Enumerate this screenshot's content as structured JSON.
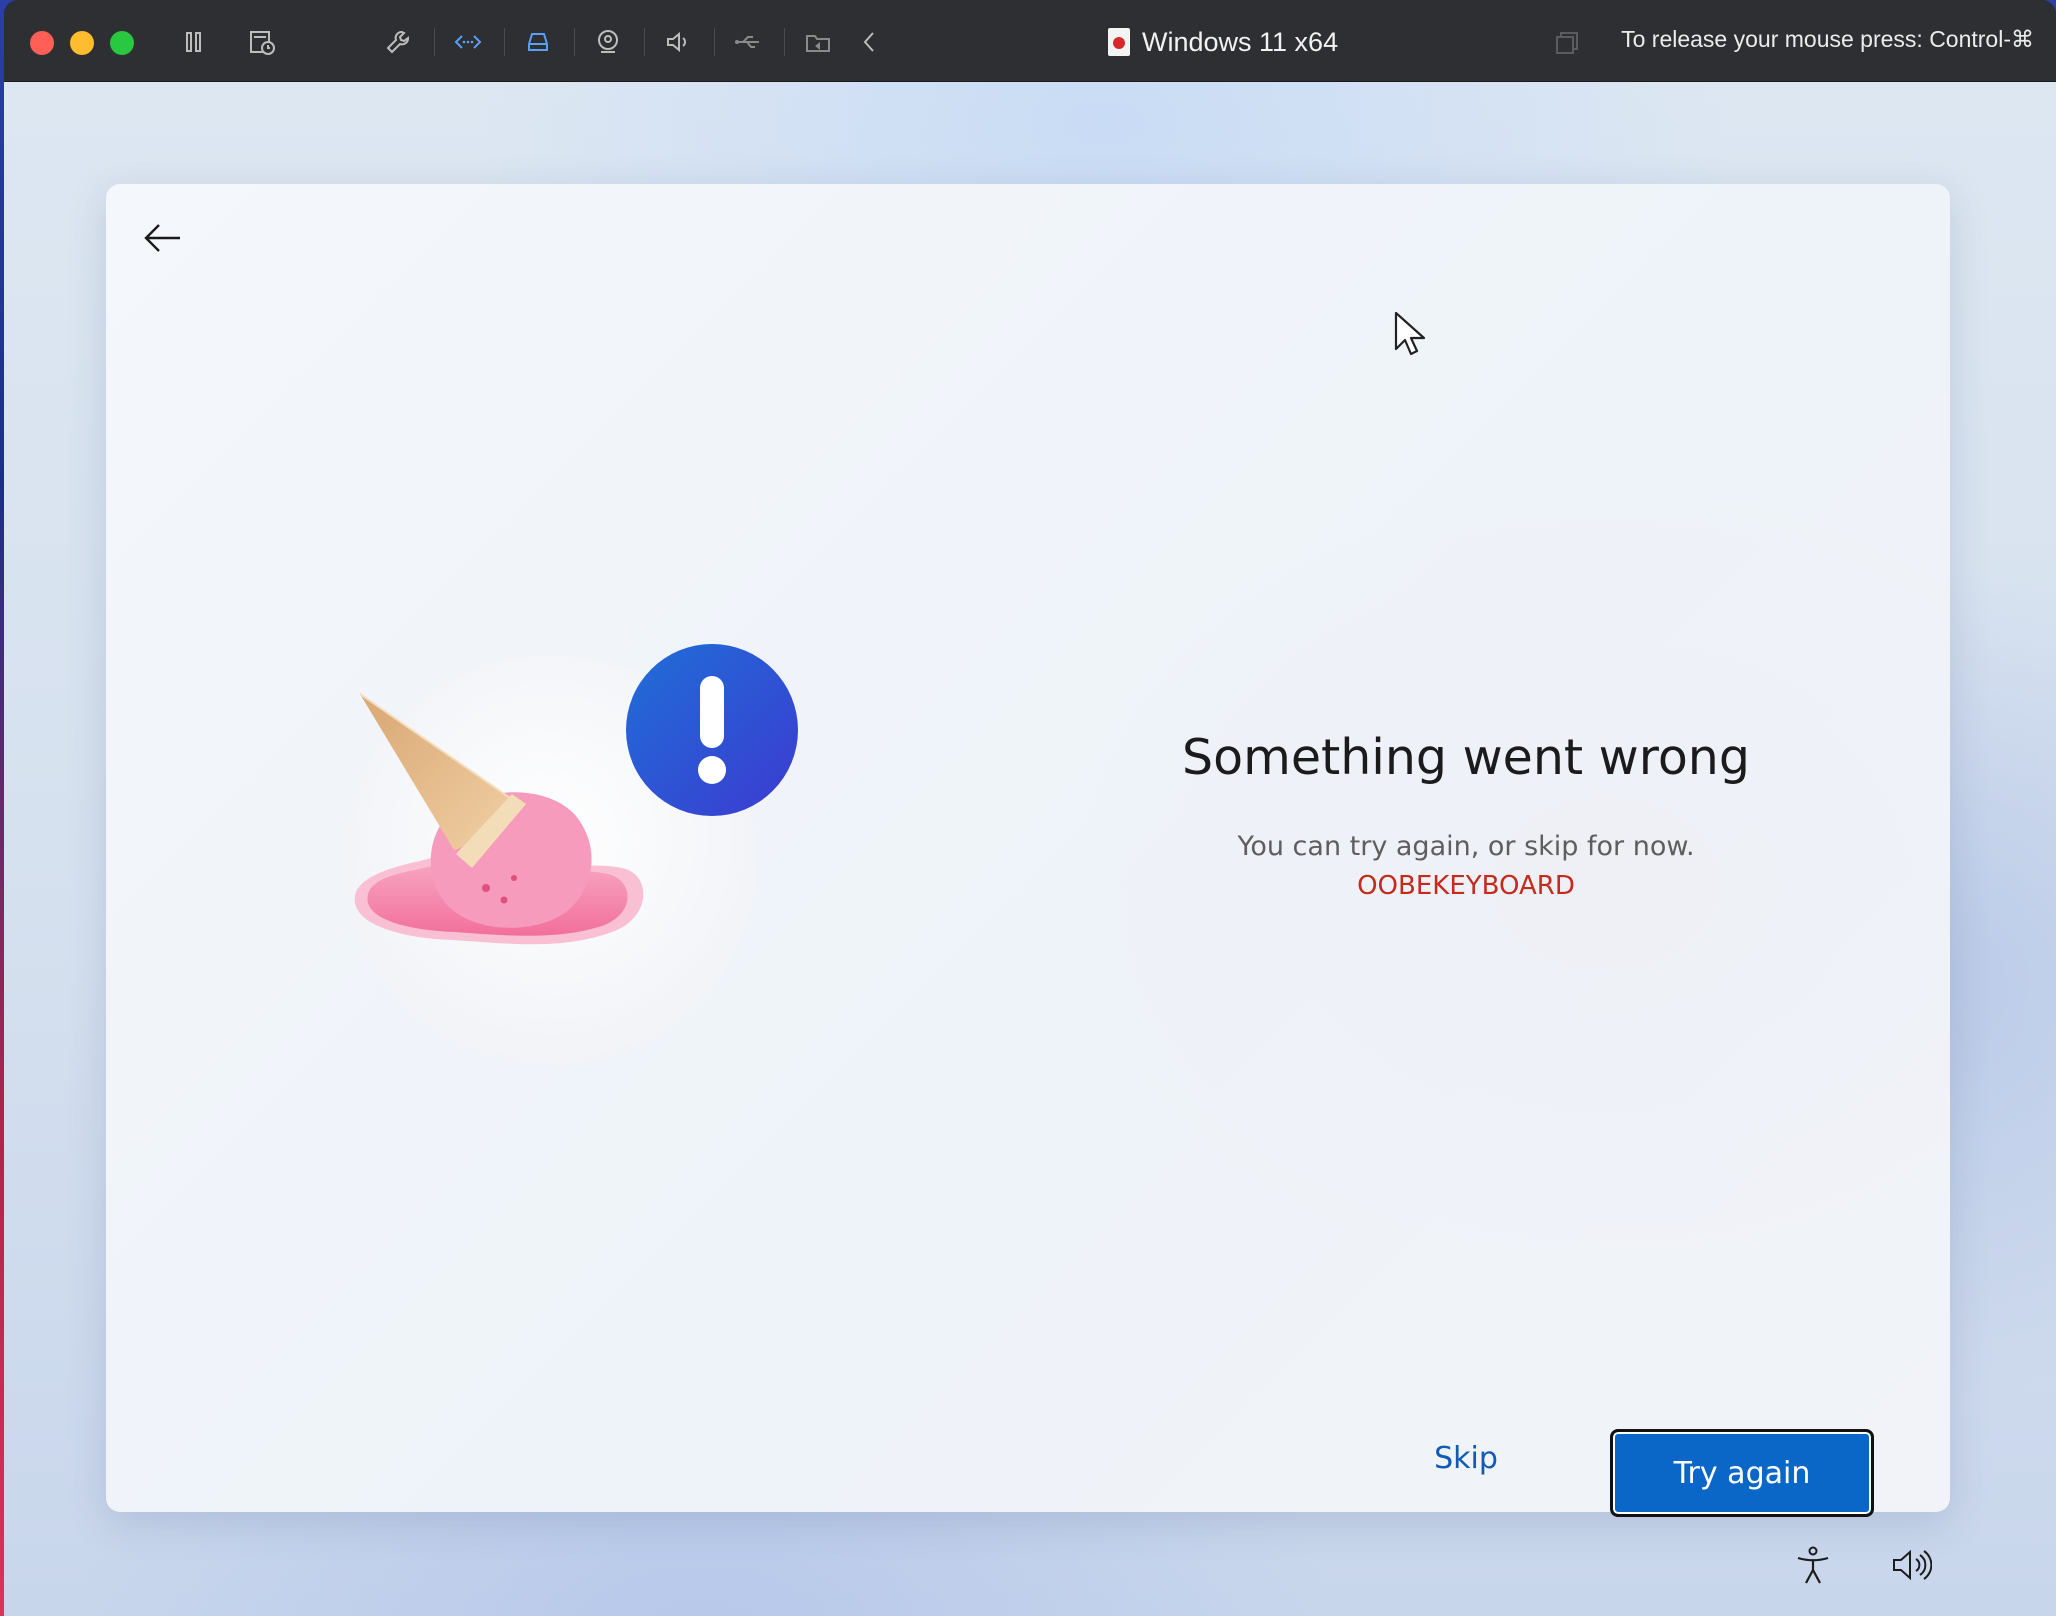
{
  "vm_window": {
    "title": "Windows 11 x64",
    "release_hint": "To release your mouse press: Control-⌘",
    "toolbar_icons": [
      "pause-icon",
      "snapshot-icon",
      "settings-wrench-icon",
      "network-icon",
      "disk-icon",
      "camera-icon",
      "sound-icon",
      "usb-icon",
      "shared-folder-icon",
      "collapse-chevron-icon",
      "copy-window-icon"
    ]
  },
  "oobe": {
    "heading": "Something went wrong",
    "message": "You can try again, or skip for now.",
    "error_code": "OOBEKEYBOARD",
    "skip_label": "Skip",
    "try_again_label": "Try again"
  },
  "tray": {
    "icons": [
      "accessibility-icon",
      "volume-icon"
    ]
  },
  "colors": {
    "accent": "#0a67c8",
    "error": "#c42b1c",
    "link": "#0f5bb5"
  }
}
